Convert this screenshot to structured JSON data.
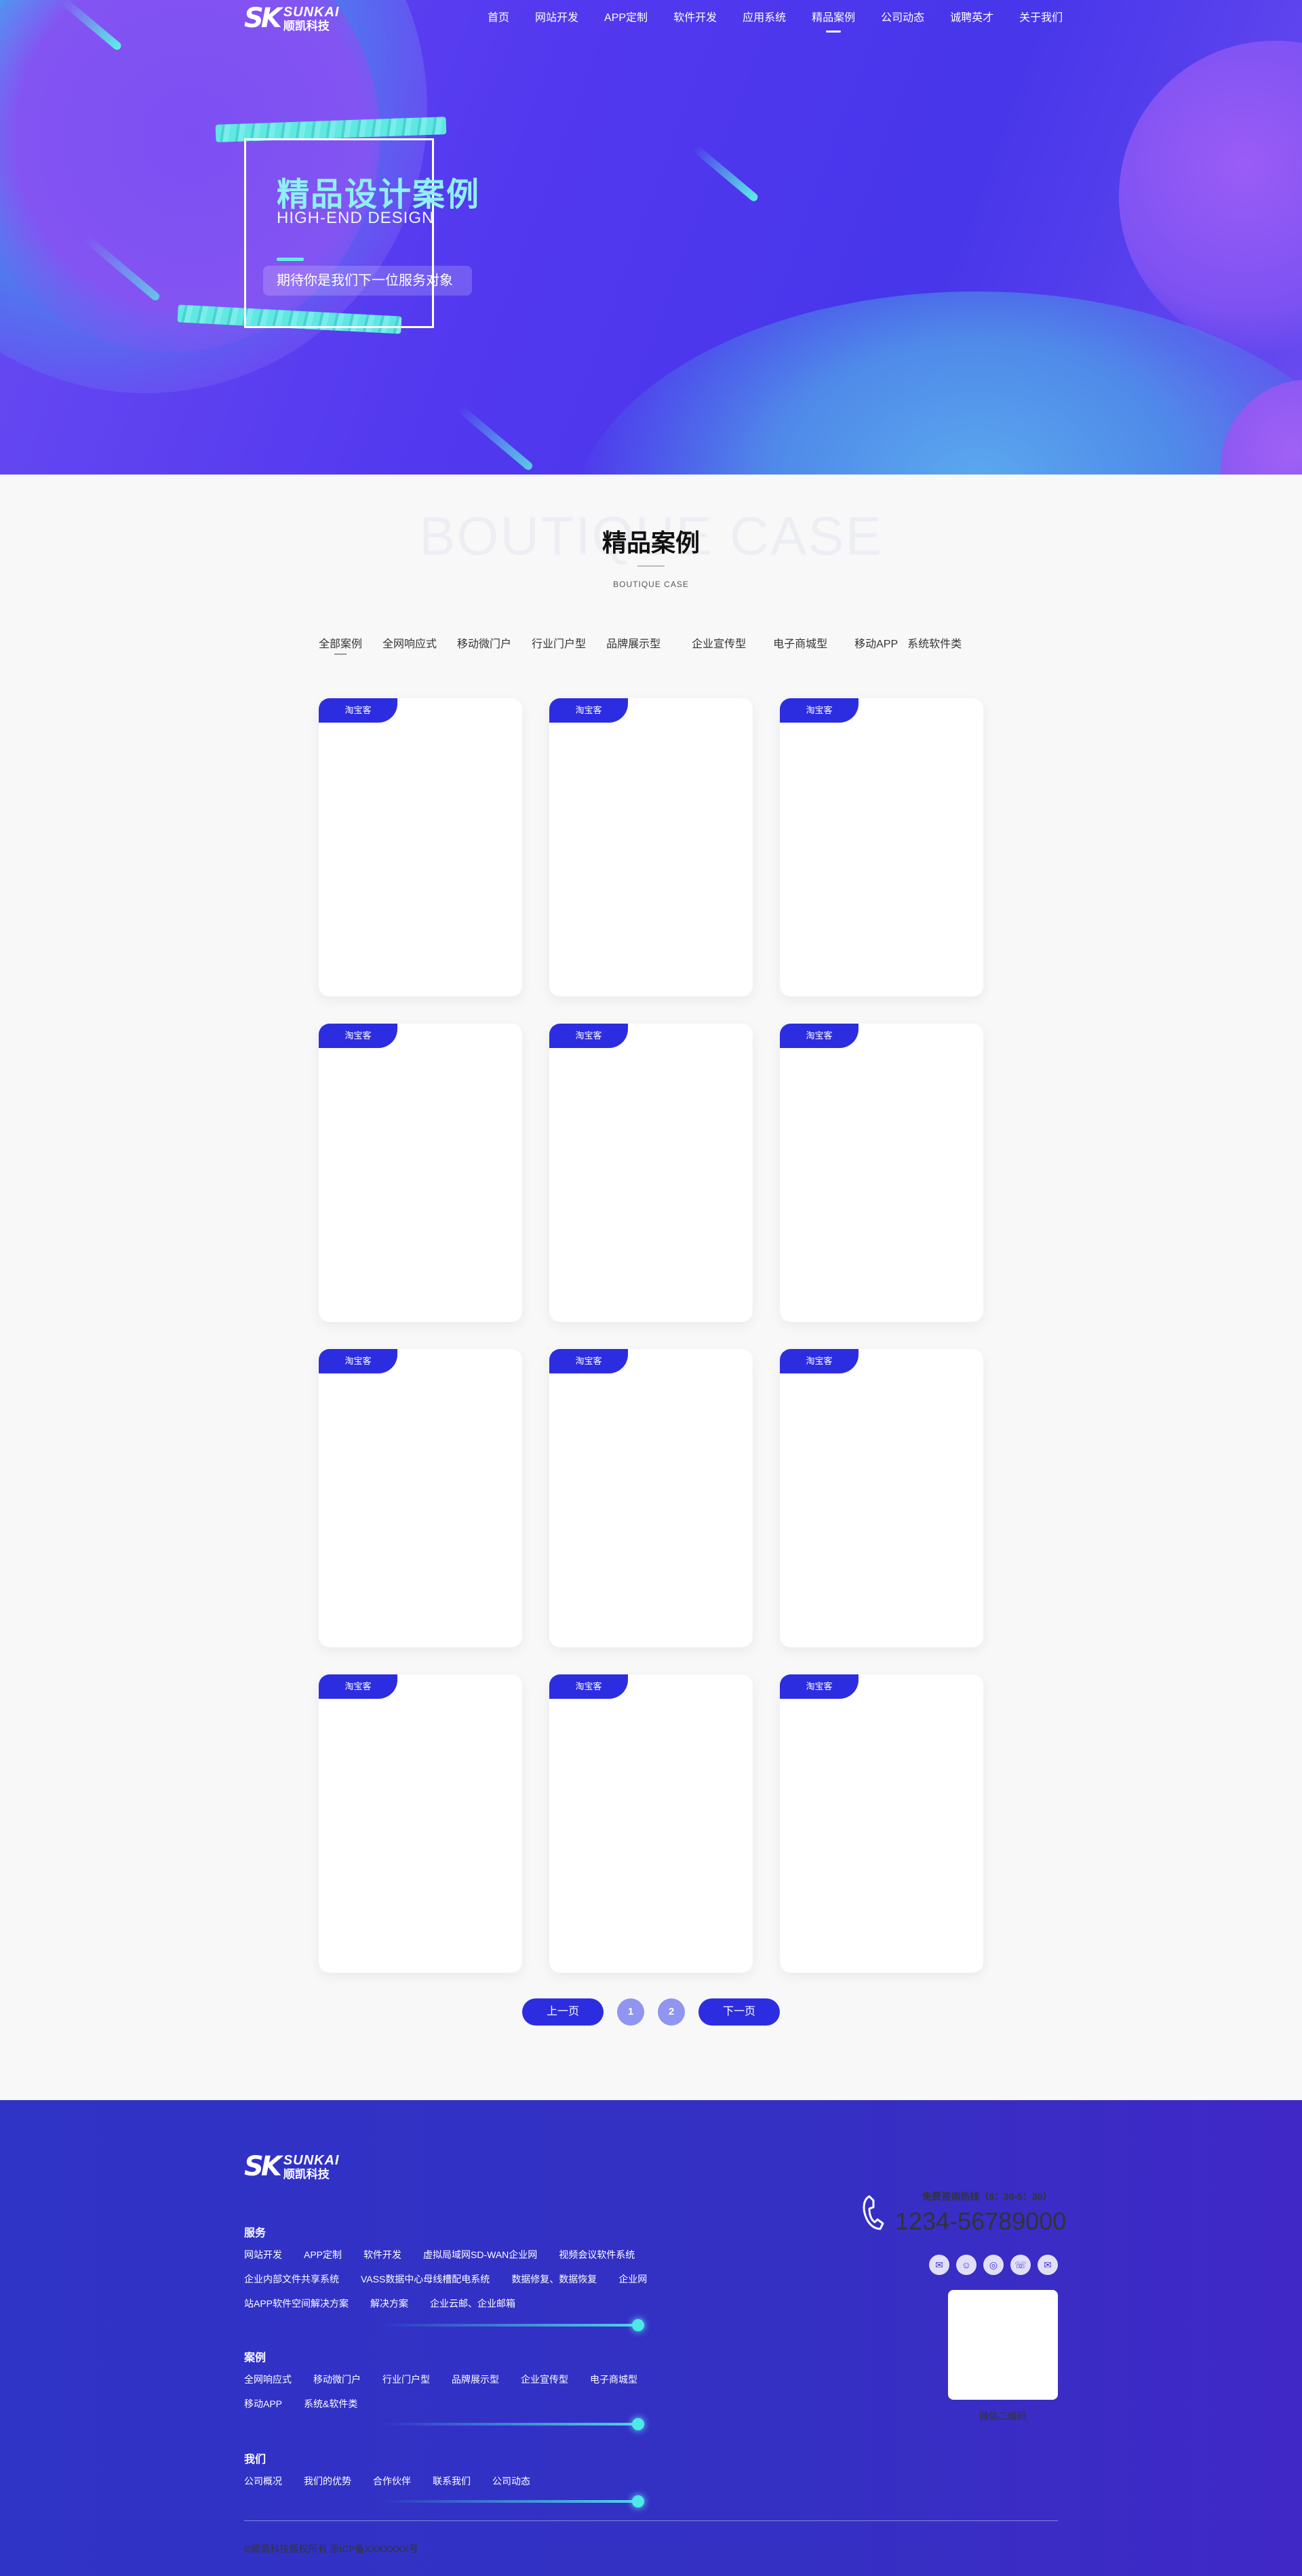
{
  "brand": {
    "mark": "SK",
    "name_en": "SUNKAI",
    "name_cn": "顺凯科技"
  },
  "nav": {
    "items": [
      {
        "label": "首页"
      },
      {
        "label": "网站开发"
      },
      {
        "label": "APP定制"
      },
      {
        "label": "软件开发"
      },
      {
        "label": "应用系统"
      },
      {
        "label": "精品案例",
        "active": true
      },
      {
        "label": "公司动态"
      },
      {
        "label": "诚聘英才"
      },
      {
        "label": "关于我们"
      }
    ]
  },
  "hero": {
    "title": "精品设计案例",
    "subtitle": "HIGH-END DESIGN",
    "tagline": "期待你是我们下一位服务对象"
  },
  "cases": {
    "bg_word": "BOUTIQUE CASE",
    "title": "精品案例",
    "subtitle": "BOUTIQUE CASE",
    "filters": [
      {
        "label": "全部案例",
        "active": true
      },
      {
        "label": "全网响应式"
      },
      {
        "label": "移动微门户"
      },
      {
        "label": "行业门户型"
      },
      {
        "label": "品牌展示型"
      },
      {
        "label": "企业宣传型"
      },
      {
        "label": "电子商城型"
      },
      {
        "label": "移动APP"
      },
      {
        "label": "系统软件类"
      }
    ],
    "card_tag": "淘宝客",
    "card_count": 12
  },
  "pagination": {
    "prev": "上一页",
    "next": "下一页",
    "pages": [
      "1",
      "2"
    ]
  },
  "footer": {
    "services_title": "服务",
    "services_rows": [
      [
        "网站开发",
        "APP定制",
        "软件开发",
        "虚拟局域网SD-WAN企业网",
        "视频会议软件系统"
      ],
      [
        "企业内部文件共享系统",
        "VASS数据中心母线槽配电系统",
        "数据修复、数据恢复",
        "企业网"
      ],
      [
        "站APP软件空间解决方案",
        "解决方案",
        "企业云邮、企业邮箱"
      ]
    ],
    "cases_title": "案例",
    "cases_rows": [
      [
        "全网响应式",
        "移动微门户",
        "行业门户型",
        "品牌展示型",
        "企业宣传型",
        "电子商城型"
      ],
      [
        "移动APP",
        "系统&软件类"
      ]
    ],
    "about_title": "我们",
    "about_row": [
      "公司概况",
      "我们的优势",
      "合作伙伴",
      "联系我们",
      "公司动态"
    ],
    "hotline_label": "免费咨询热线（8：30-5：30）",
    "phone": "1234-56789000",
    "social_icons": [
      "qq-icon",
      "wechat-icon",
      "weibo-icon",
      "phone-icon",
      "mail-icon"
    ],
    "qr_label": "微信二维码",
    "copyright": "©顺凯科技版权所有   浙ICP备XXXXXXX号"
  },
  "colors": {
    "accent": "#2c2de0",
    "cyan": "#5ef0e0",
    "footer_bg": "#3430c4"
  }
}
